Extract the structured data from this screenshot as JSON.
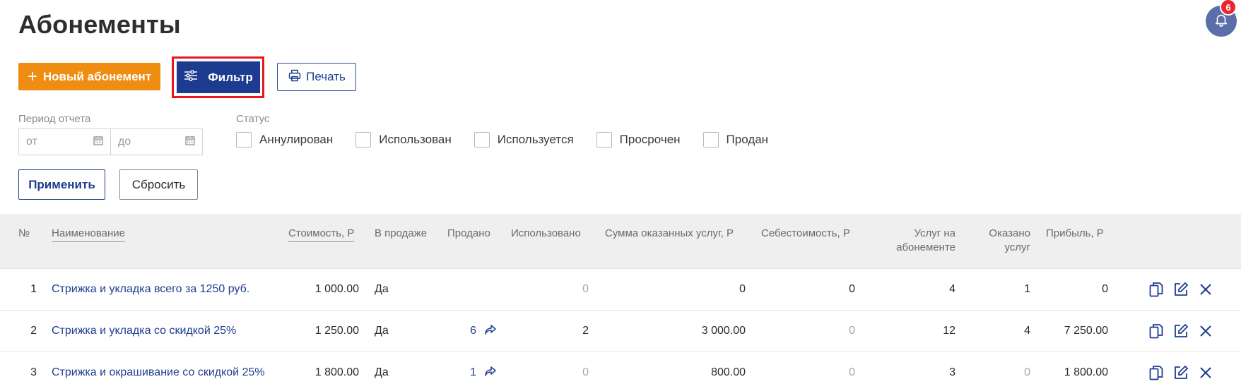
{
  "page": {
    "title": "Абонементы"
  },
  "notifications": {
    "count": "6"
  },
  "toolbar": {
    "new_label": "Новый абонемент",
    "filter_label": "Фильтр",
    "print_label": "Печать"
  },
  "filters": {
    "period_label": "Период отчета",
    "from_placeholder": "от",
    "to_placeholder": "до",
    "status_label": "Статус",
    "statuses": [
      "Аннулирован",
      "Использован",
      "Используется",
      "Просрочен",
      "Продан"
    ],
    "apply_label": "Применить",
    "reset_label": "Сбросить"
  },
  "table": {
    "headers": {
      "num": "№",
      "name": "Наименование",
      "cost": "Стоимость, Р",
      "on_sale": "В продаже",
      "sold": "Продано",
      "used": "Использовано",
      "services_sum": "Сумма оказанных услуг, Р",
      "prime_cost": "Себестоимость, Р",
      "services_in_sub_1": "Услуг на",
      "services_in_sub_2": "абонементе",
      "rendered_1": "Оказано",
      "rendered_2": "услуг",
      "profit": "Прибыль, Р"
    },
    "rows": [
      {
        "num": "1",
        "name": "Стрижка и укладка всего за 1250 руб.",
        "cost": "1 000.00",
        "on_sale": "Да",
        "sold": "",
        "used": "0",
        "services_sum": "0",
        "prime_cost": "0",
        "services_in_sub": "4",
        "rendered": "1",
        "profit": "0"
      },
      {
        "num": "2",
        "name": "Стрижка и укладка со скидкой 25%",
        "cost": "1 250.00",
        "on_sale": "Да",
        "sold": "6",
        "used": "2",
        "services_sum": "3 000.00",
        "prime_cost": "0",
        "services_in_sub": "12",
        "rendered": "4",
        "profit": "7 250.00"
      },
      {
        "num": "3",
        "name": "Стрижка и окрашивание со скидкой 25%",
        "cost": "1 800.00",
        "on_sale": "Да",
        "sold": "1",
        "used": "0",
        "services_sum": "800.00",
        "prime_cost": "0",
        "services_in_sub": "3",
        "rendered": "0",
        "profit": "1 800.00"
      }
    ]
  },
  "colors": {
    "accent_orange": "#ef8c12",
    "primary_blue": "#1e3c8f",
    "highlight_red": "#e8161d",
    "badge_red": "#e8262b"
  },
  "icons": [
    "plus-icon",
    "sliders-icon",
    "printer-icon",
    "calendar-icon",
    "bell-icon",
    "share-icon",
    "copy-icon",
    "edit-icon",
    "delete-icon"
  ]
}
